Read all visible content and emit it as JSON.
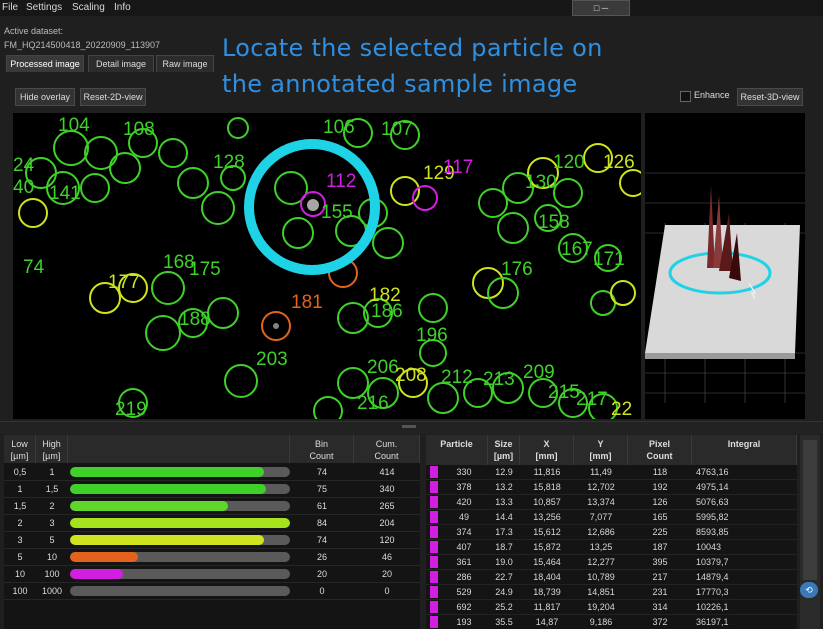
{
  "menu": [
    "File",
    "Settings",
    "Scaling",
    "Info"
  ],
  "window_control": "□ ─",
  "dataset": {
    "label": "Active dataset:",
    "value": "FM_HQ214500418_20220909_113907"
  },
  "tabs": [
    "Processed image",
    "Detail image",
    "Raw image"
  ],
  "caption_line1": "Locate the selected particle on",
  "caption_line2": "the annotated sample image",
  "buttons": {
    "hide_overlay": "Hide overlay",
    "reset_2d": "Reset-2D-view",
    "enhance": "Enhance",
    "reset_3d": "Reset-3D-view"
  },
  "colors": {
    "green": "#3fd12a",
    "yellow": "#cfe41e",
    "orange": "#e4631c",
    "magenta": "#d21ee0",
    "cyan": "#1fd3e6",
    "caption_blue": "#2f8fe0"
  },
  "image_labels": [
    "104",
    "108",
    "128",
    "106",
    "107",
    "129",
    "117",
    "120",
    "126",
    "40",
    "141",
    "112",
    "155",
    "130",
    "24",
    "158",
    "167",
    "171",
    "74",
    "168",
    "175",
    "177",
    "176",
    "182",
    "188",
    "181",
    "186",
    "196",
    "203",
    "206",
    "208",
    "212",
    "213",
    "209",
    "215",
    "219",
    "216",
    "217",
    "22"
  ],
  "dist_table": {
    "headers": {
      "low": "Low\n[µm]",
      "high": "High\n[µm]",
      "bin": "Bin\nCount",
      "cum": "Cum.\nCount"
    },
    "rows": [
      {
        "low": "0,5",
        "high": "1",
        "fill": 0.88,
        "color": "#3fd12a",
        "bin": "74",
        "cum": "414"
      },
      {
        "low": "1",
        "high": "1,5",
        "fill": 0.89,
        "color": "#3fd12a",
        "bin": "75",
        "cum": "340"
      },
      {
        "low": "1,5",
        "high": "2",
        "fill": 0.72,
        "color": "#5fd62a",
        "bin": "61",
        "cum": "265"
      },
      {
        "low": "2",
        "high": "3",
        "fill": 1.0,
        "color": "#a6e21e",
        "bin": "84",
        "cum": "204"
      },
      {
        "low": "3",
        "high": "5",
        "fill": 0.88,
        "color": "#cfe41e",
        "bin": "74",
        "cum": "120"
      },
      {
        "low": "5",
        "high": "10",
        "fill": 0.31,
        "color": "#e4631c",
        "bin": "26",
        "cum": "46"
      },
      {
        "low": "10",
        "high": "100",
        "fill": 0.24,
        "color": "#d21ee0",
        "bin": "20",
        "cum": "20"
      },
      {
        "low": "100",
        "high": "1000",
        "fill": 0.0,
        "color": "#888888",
        "bin": "0",
        "cum": "0"
      }
    ]
  },
  "particle_table": {
    "headers": {
      "particle": "Particle",
      "size": "Size\n[µm]",
      "x": "X\n[mm]",
      "y": "Y\n[mm]",
      "pixel": "Pixel\nCount",
      "integral": "Integral"
    },
    "rows": [
      {
        "particle": "330",
        "size": "12.9",
        "x": "11,816",
        "y": "11,49",
        "pixel": "118",
        "integral": "4763,16"
      },
      {
        "particle": "378",
        "size": "13.2",
        "x": "15,818",
        "y": "12,702",
        "pixel": "192",
        "integral": "4975,14"
      },
      {
        "particle": "420",
        "size": "13.3",
        "x": "10,857",
        "y": "13,374",
        "pixel": "126",
        "integral": "5076,63"
      },
      {
        "particle": "49",
        "size": "14.4",
        "x": "13,256",
        "y": "7,077",
        "pixel": "165",
        "integral": "5995,82"
      },
      {
        "particle": "374",
        "size": "17.3",
        "x": "15,612",
        "y": "12,686",
        "pixel": "225",
        "integral": "8593,85"
      },
      {
        "particle": "407",
        "size": "18.7",
        "x": "15,872",
        "y": "13,25",
        "pixel": "187",
        "integral": "10043"
      },
      {
        "particle": "361",
        "size": "19.0",
        "x": "15,464",
        "y": "12,277",
        "pixel": "395",
        "integral": "10379,7"
      },
      {
        "particle": "286",
        "size": "22.7",
        "x": "18,404",
        "y": "10,789",
        "pixel": "217",
        "integral": "14879,4"
      },
      {
        "particle": "529",
        "size": "24.9",
        "x": "18,739",
        "y": "14,851",
        "pixel": "231",
        "integral": "17770,3"
      },
      {
        "particle": "692",
        "size": "25.2",
        "x": "11,817",
        "y": "19,204",
        "pixel": "314",
        "integral": "10226,1"
      },
      {
        "particle": "193",
        "size": "35.5",
        "x": "14,87",
        "y": "9,186",
        "pixel": "372",
        "integral": "36197,1"
      }
    ]
  }
}
